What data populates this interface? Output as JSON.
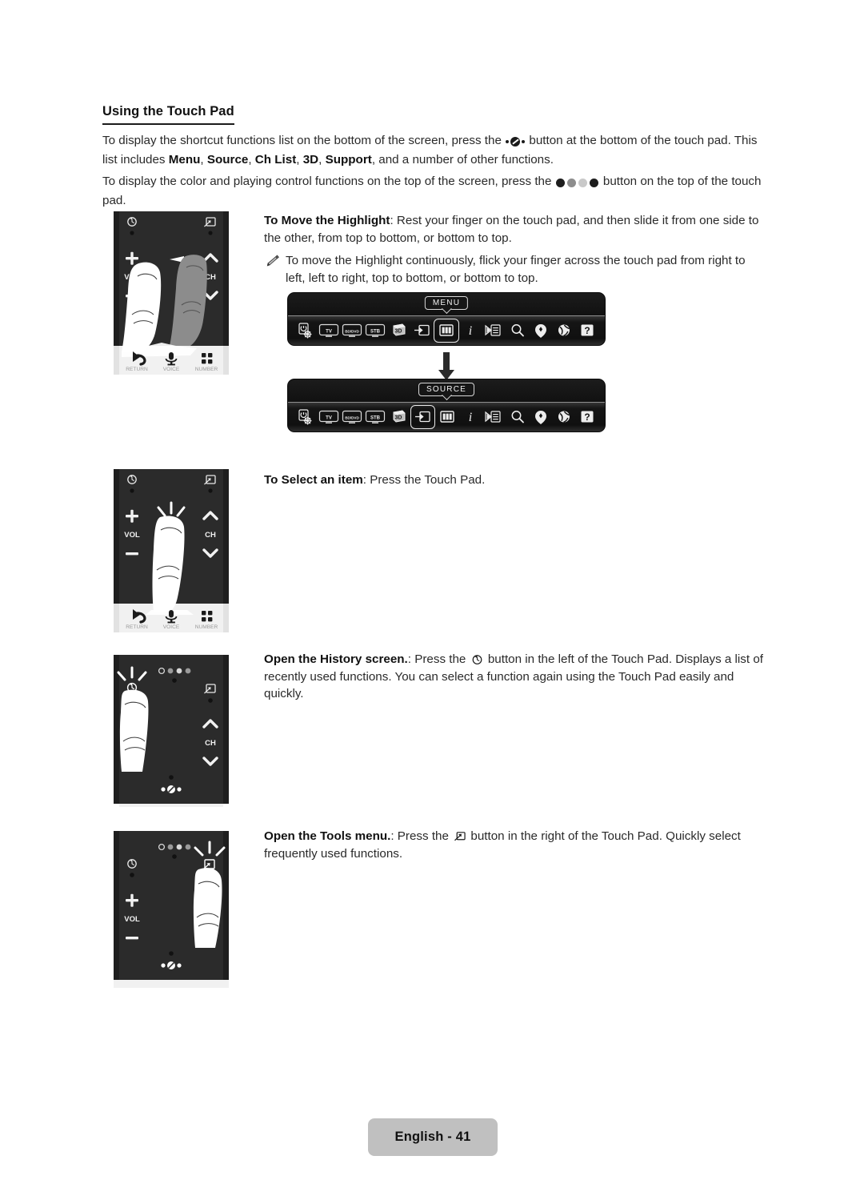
{
  "document": {
    "heading": "Using the Touch Pad",
    "footer_label": "English - 41"
  },
  "intro": {
    "p1_a": "To display the shortcut functions list on the bottom of the screen, press the ",
    "p1_b": " button at the bottom of the touch pad. This list includes ",
    "p1_menu": "Menu",
    "p1_sep1": ", ",
    "p1_source": "Source",
    "p1_sep2": ", ",
    "p1_chlist": "Ch List",
    "p1_sep3": ", ",
    "p1_3d": "3D",
    "p1_sep4": ", ",
    "p1_support": "Support",
    "p1_c": ", and a number of other functions.",
    "p2_a": "To display the color and playing control functions on the top of the screen, press the ",
    "p2_b": " button on the top of the touch pad."
  },
  "sections": {
    "move": {
      "title": "To Move the Highlight",
      "body": ": Rest your finger on the touch pad, and then slide it from one side to the other, from top to bottom, or bottom to top.",
      "note": "To move the Highlight continuously, flick your finger across the touch pad from right to left, left to right, top to bottom, or bottom to top."
    },
    "select": {
      "title": "To Select an item",
      "body": ": Press the Touch Pad."
    },
    "history": {
      "title": "Open the History screen.",
      "body_a": ": Press the ",
      "body_b": " button in the left of the Touch Pad. Displays a list of recently used functions. You can select a function again using the Touch Pad easily and quickly."
    },
    "tools": {
      "title": "Open the Tools menu.",
      "body_a": ": Press the ",
      "body_b": " button in the right of the Touch Pad. Quickly select frequently used functions."
    }
  },
  "remote": {
    "labels": {
      "vol": "VOL",
      "ch": "CH",
      "plus": "+",
      "minus": "−",
      "return": "RETURN",
      "voice": "VOICE",
      "number": "NUMBER"
    },
    "colors": {
      "body": "#2b2b2b",
      "body_dark": "#232323",
      "bottom_panel": "#f1f1f1",
      "finger": "#ffffff",
      "finger_shadow": "#8c8c8c"
    },
    "illustrations": [
      {
        "id": "swipe",
        "caption_ref": "move"
      },
      {
        "id": "press",
        "caption_ref": "select"
      },
      {
        "id": "history-btn",
        "caption_ref": "history"
      },
      {
        "id": "tools-btn",
        "caption_ref": "tools"
      }
    ]
  },
  "menu_bars": [
    {
      "id": "menu-bar",
      "callout": "MENU",
      "selected_index": 6,
      "icons": [
        "power-settings-icon",
        "tv-icon",
        "bd-dvd-icon",
        "stb-icon",
        "three-d-icon",
        "source-input-icon",
        "menu-panel-icon",
        "info-icon",
        "ch-list-icon",
        "search-icon",
        "apps-icon",
        "web-browser-icon",
        "support-help-icon"
      ],
      "icon_labels": [
        "",
        "TV",
        "BD/DVD",
        "STB",
        "3D",
        "",
        "",
        "i",
        "",
        "",
        "",
        "",
        "?"
      ]
    },
    {
      "id": "source-bar",
      "callout": "SOURCE",
      "selected_index": 5,
      "icons": [
        "power-settings-icon",
        "tv-icon",
        "bd-dvd-icon",
        "stb-icon",
        "three-d-icon",
        "source-input-icon",
        "menu-panel-icon",
        "info-icon",
        "ch-list-icon",
        "search-icon",
        "apps-icon",
        "web-browser-icon",
        "support-help-icon"
      ],
      "icon_labels": [
        "",
        "TV",
        "BD/DVD",
        "STB",
        "3D",
        "",
        "",
        "i",
        "",
        "",
        "",
        "",
        "?"
      ]
    }
  ],
  "glyphs": {
    "color_buttons": [
      "#1d1d1d",
      "#8d8d8d",
      "#c9c9c9",
      "#1d1d1d"
    ],
    "touch_button_name": "touchpad-shortcut-icon",
    "history_icon_name": "history-icon",
    "tools_icon_name": "tools-icon"
  }
}
